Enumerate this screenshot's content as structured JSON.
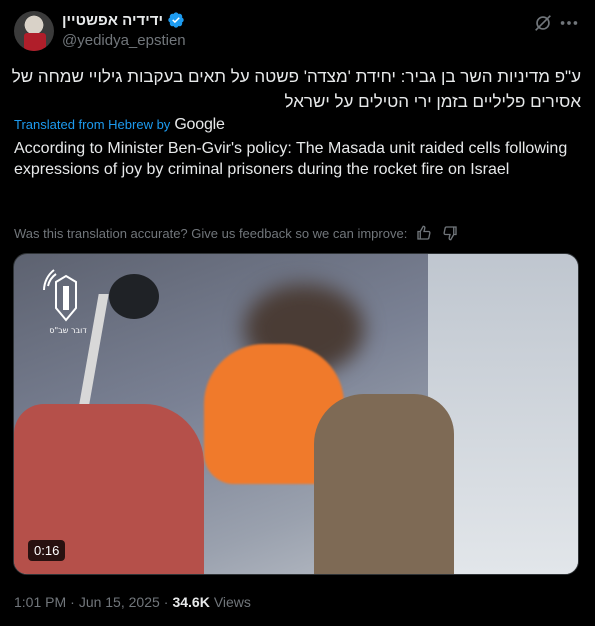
{
  "author": {
    "display_name": "ידידיה אפשטיין",
    "handle": "@yedidya_epstien",
    "verified": true
  },
  "post": {
    "original_text": "ע\"פ מדיניות השר בן גביר: יחידת 'מצדה' פשטה על תאים בעקבות גילויי שמחה של אסירים פליליים בזמן ירי הטילים על ישראל",
    "translated_label": "Translated from Hebrew by",
    "translator_brand": "Google",
    "translated_text": "According to Minister Ben-Gvir's policy: The Masada unit raided cells following expressions of joy by criminal prisoners during the rocket fire on Israel",
    "feedback_prompt": "Was this translation accurate? Give us feedback so we can improve:"
  },
  "media": {
    "type": "video",
    "duration": "0:16",
    "watermark_text": "דובר שב\"ס"
  },
  "meta": {
    "time": "1:01 PM",
    "separator": "·",
    "date": "Jun 15, 2025",
    "views_count": "34.6K",
    "views_label": "Views"
  },
  "icons": {
    "verified": "verified-badge-icon",
    "grok": "grok-icon",
    "more": "more-icon",
    "thumbs_up": "thumbs-up-icon",
    "thumbs_down": "thumbs-down-icon"
  },
  "colors": {
    "background": "#000000",
    "text": "#e7e9ea",
    "muted": "#71767b",
    "accent": "#1d9bf0"
  }
}
